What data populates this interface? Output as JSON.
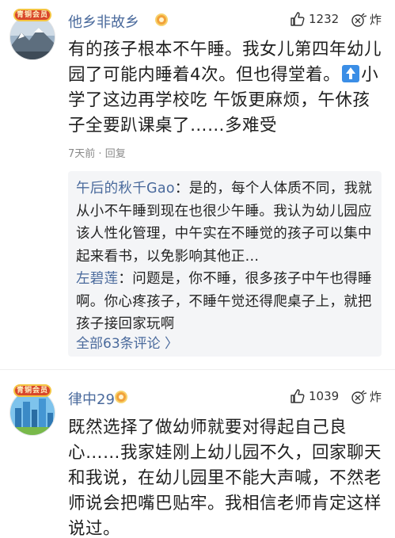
{
  "comments": [
    {
      "avatar_badge": "青铜会员",
      "username": "他乡非故乡",
      "like_count": "1232",
      "zan_label": "炸",
      "text_before_icon": "有的孩子根本不午睡。我女儿第四年幼儿园了可能内睡着4次。但也得堂着。",
      "text_after_icon": "小学了这边再学校吃 午饭更麻烦，午休孩子全要趴课桌了……多难受",
      "time": "7天前",
      "separator": "·",
      "reply_label": "回复",
      "replies": [
        {
          "name": "午后的秋千Gao",
          "text": "：是的，每个人体质不同，我就从小不午睡到现在也很少午睡。我认为幼儿园应该人性化管理，中午实在不睡觉的孩子可以集中起来看书，以免影响其他正..."
        },
        {
          "name": "左碧莲",
          "text": "：问题是，你不睡，很多孩子中午也得睡啊。你心疼孩子，不睡午觉还得爬桌子上，就把孩子接回家玩啊"
        }
      ],
      "more_replies": "全部63条评论 〉"
    },
    {
      "avatar_badge": "青铜会员",
      "username": "律中29",
      "like_count": "1039",
      "zan_label": "炸",
      "text": "既然选择了做幼师就要对得起自己良心……我家娃刚上幼儿园不久，回家聊天和我说，在幼儿园里不能大声喊，不然老师说会把嘴巴贴牢。我相信老师肯定这样说过。"
    }
  ],
  "icons": [
    "thumbs-up-icon",
    "bomb-icon",
    "level-badge-icon",
    "up-arrow-icon"
  ],
  "colors": {
    "username": "#4a6a9c",
    "reply_bg": "#f4f5f7",
    "badge": "#d9472b",
    "arrow": "#3b8ee6"
  }
}
